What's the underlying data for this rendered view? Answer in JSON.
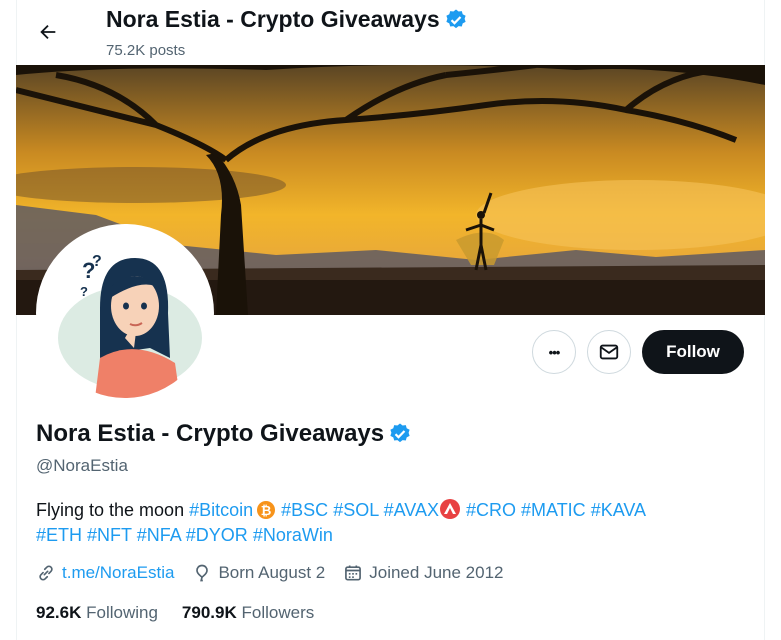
{
  "header": {
    "title": "Nora Estia - Crypto Giveaways",
    "posts": "75.2K posts"
  },
  "profile": {
    "name": "Nora Estia - Crypto Giveaways",
    "handle": "@NoraEstia",
    "bio_text": "Flying to the moon",
    "hashtags_line1": [
      "#Bitcoin",
      "#BSC",
      "#SOL",
      "#AVAX",
      "#CRO",
      "#MATIC",
      "#KAVA"
    ],
    "hashtags_line2": [
      "#ETH",
      "#NFT",
      "#NFA",
      "#DYOR",
      "#NoraWin"
    ],
    "website": "t.me/NoraEstia",
    "born": "Born August 2",
    "joined": "Joined June 2012",
    "following_count": "92.6K",
    "following_label": "Following",
    "followers_count": "790.9K",
    "followers_label": "Followers"
  },
  "actions": {
    "more": "•••",
    "follow": "Follow"
  },
  "colors": {
    "accent": "#1d9bf0",
    "text": "#0f1419",
    "muted": "#536471",
    "follow_bg": "#0f1419"
  },
  "icons": [
    "back-arrow-icon",
    "verified-badge-icon",
    "more-icon",
    "mail-icon",
    "link-icon",
    "birthday-icon",
    "calendar-icon",
    "bitcoin-emoji-icon",
    "avax-emoji-icon"
  ]
}
